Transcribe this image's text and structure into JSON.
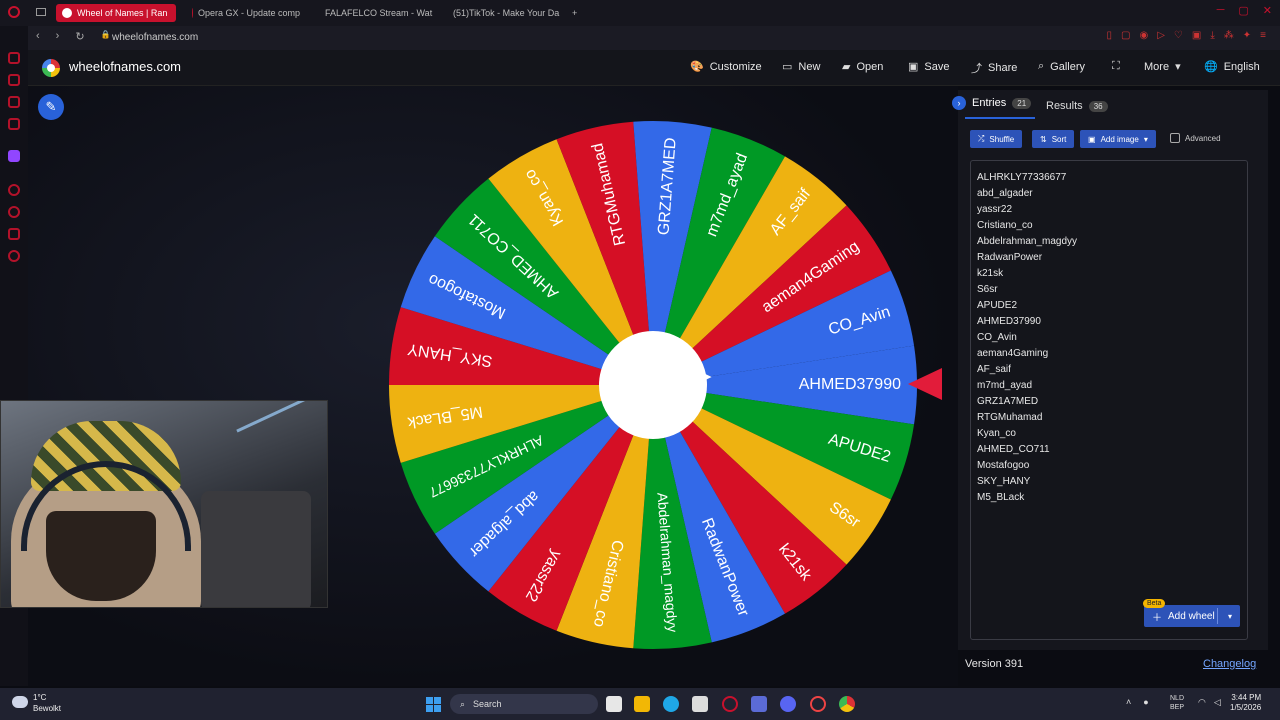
{
  "browser": {
    "tabs": [
      {
        "label": "Wheel of Names | Ran",
        "active": true
      },
      {
        "label": "Opera GX - Update comp",
        "active": false
      },
      {
        "label": "FALAFELCO Stream - Wat",
        "active": false
      },
      {
        "label": "(51)TikTok - Make Your Da",
        "active": false
      }
    ],
    "new_tab": "+",
    "url": "wheelofnames.com",
    "nav": {
      "back": "‹",
      "forward": "›",
      "reload": "↻",
      "lock": "🔒"
    },
    "window": {
      "minimize": "─",
      "maximize": "▢",
      "close": "✕"
    }
  },
  "site": {
    "title": "wheelofnames.com",
    "nav": [
      {
        "label": "Customize",
        "icon": "palette-icon",
        "glyph": "🎨"
      },
      {
        "label": "New",
        "icon": "file-icon",
        "glyph": "▭"
      },
      {
        "label": "Open",
        "icon": "folder-icon",
        "glyph": "▰"
      },
      {
        "label": "Save",
        "icon": "save-icon",
        "glyph": "▣"
      },
      {
        "label": "Share",
        "icon": "share-icon",
        "glyph": "⤴"
      },
      {
        "label": "Gallery",
        "icon": "search-icon",
        "glyph": "⌕"
      },
      {
        "label": "",
        "icon": "fullscreen-icon",
        "glyph": "⛶"
      },
      {
        "label": "More",
        "icon": "chevron-down-icon",
        "glyph": "▾"
      },
      {
        "label": "English",
        "icon": "globe-icon",
        "glyph": "🌐"
      }
    ]
  },
  "wheel": {
    "colors": [
      "#3369e8",
      "#009925",
      "#eeb211",
      "#d50f25"
    ],
    "segments": [
      "AHMED37990",
      "APUDE2",
      "S6sr",
      "k21sk",
      "RadwanPower",
      "Abdelrahman_magdyy",
      "Cristiano_co",
      "yassr22",
      "abd_algader",
      "ALHRKLY77336677",
      "M5_BLack",
      "SKY_HANY",
      "Mostafogoo",
      "AHMED_CO711",
      "Kyan_co",
      "RTGMuhamad",
      "GRZ1A7MED",
      "m7md_ayad",
      "AF_saif",
      "aeman4Gaming",
      "CO_Avin"
    ],
    "hub_color": "#ffffff",
    "pointer_color": "#e21c3a"
  },
  "panel": {
    "tab_entries": "Entries",
    "entries_count": "21",
    "tab_results": "Results",
    "results_count": "36",
    "shuffle": "Shuffle",
    "sort": "Sort",
    "add_image": "Add image",
    "advanced": "Advanced",
    "entries": [
      "ALHRKLY77336677",
      "abd_algader",
      "yassr22",
      "Cristiano_co",
      "Abdelrahman_magdyy",
      "RadwanPower",
      "k21sk",
      "S6sr",
      "APUDE2",
      "AHMED37990",
      "CO_Avin",
      "aeman4Gaming",
      "AF_saif",
      "m7md_ayad",
      "GRZ1A7MED",
      "RTGMuhamad",
      "Kyan_co",
      "AHMED_CO711",
      "Mostafogoo",
      "SKY_HANY",
      "M5_BLack"
    ],
    "beta": "Beta",
    "add_wheel": "Add wheel",
    "version": "Version 391",
    "changelog": "Changelog"
  },
  "taskbar": {
    "temp": "1°C",
    "weather": "Bewolkt",
    "search": "Search",
    "lang1": "NLD",
    "lang2": "BEP",
    "time": "3:44 PM",
    "date": "1/5/2026"
  }
}
